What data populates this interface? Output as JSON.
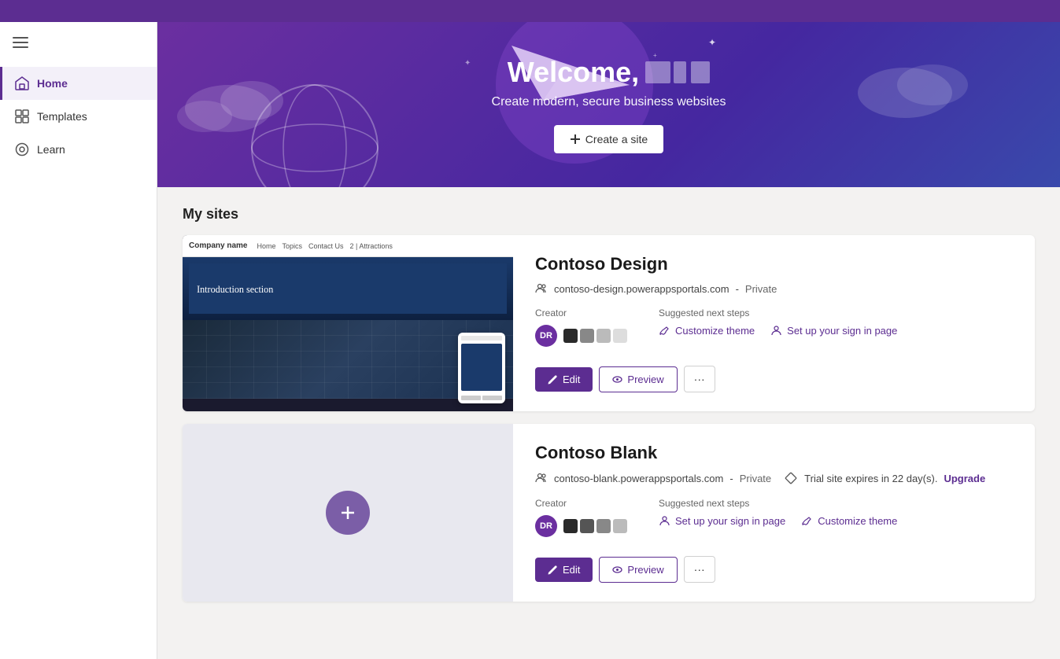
{
  "topbar": {},
  "sidebar": {
    "hamburger_label": "☰",
    "items": [
      {
        "id": "home",
        "label": "Home",
        "active": true
      },
      {
        "id": "templates",
        "label": "Templates",
        "active": false
      },
      {
        "id": "learn",
        "label": "Learn",
        "active": false
      }
    ]
  },
  "hero": {
    "title_prefix": "Welcome,",
    "subtitle": "Create modern, secure business websites",
    "create_btn_label": "Create a site"
  },
  "my_sites": {
    "section_title": "My sites",
    "sites": [
      {
        "id": "contoso-design",
        "name": "Contoso Design",
        "url": "contoso-design.powerappsportals.com",
        "privacy": "Private",
        "creator_label": "Creator",
        "creator_initials": "DR",
        "theme_colors": [
          "#2a2a2a",
          "#888",
          "#bbb",
          "#ddd"
        ],
        "suggested_label": "Suggested next steps",
        "steps": [
          {
            "id": "customize-theme",
            "label": "Customize theme"
          },
          {
            "id": "setup-signin",
            "label": "Set up your sign in page"
          }
        ],
        "edit_label": "Edit",
        "preview_label": "Preview",
        "more_label": "···",
        "trial": null
      },
      {
        "id": "contoso-blank",
        "name": "Contoso Blank",
        "url": "contoso-blank.powerappsportals.com",
        "privacy": "Private",
        "creator_label": "Creator",
        "creator_initials": "DR",
        "theme_colors": [
          "#2a2a2a",
          "#555",
          "#888",
          "#bbb"
        ],
        "suggested_label": "Suggested next steps",
        "steps": [
          {
            "id": "setup-signin-2",
            "label": "Set up your sign in page"
          },
          {
            "id": "customize-theme-2",
            "label": "Customize theme"
          }
        ],
        "edit_label": "Edit",
        "preview_label": "Preview",
        "more_label": "···",
        "trial": "Trial site expires in 22 day(s).",
        "upgrade_label": "Upgrade"
      }
    ]
  },
  "icons": {
    "home": "⌂",
    "templates": "⊞",
    "learn": "◉",
    "edit": "✏",
    "preview": "👁",
    "plus": "+",
    "people": "👥",
    "brush": "🖌",
    "person": "👤",
    "diamond": "◆"
  }
}
